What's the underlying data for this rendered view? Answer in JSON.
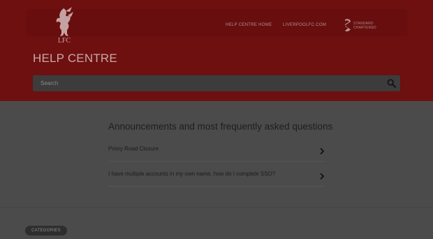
{
  "header": {
    "logo_label": "LFC",
    "nav": {
      "help_home": "HELP CENTRE HOME",
      "lfc_site": "LIVERPOOLFC.COM"
    },
    "sponsor_line1": "STANDARD",
    "sponsor_line2": "CHARTERED",
    "title": "HELP CENTRE"
  },
  "search": {
    "placeholder": "Search",
    "icon": "search-icon"
  },
  "announcements": {
    "title": "Announcements and most frequently asked questions",
    "items": [
      {
        "label": "Priory Road Closure",
        "icon": "chevron-right-icon"
      },
      {
        "label": "I have multiple accounts in my own name, how do I complete SSO?",
        "icon": "chevron-right-icon"
      }
    ]
  },
  "categories": {
    "label": "CATEGORIES"
  },
  "colors": {
    "header_bg": "#6e0f10",
    "main_bg": "#4b4b4b",
    "search_bg": "#3c3c3c",
    "title_text": "#c8a9a9"
  }
}
